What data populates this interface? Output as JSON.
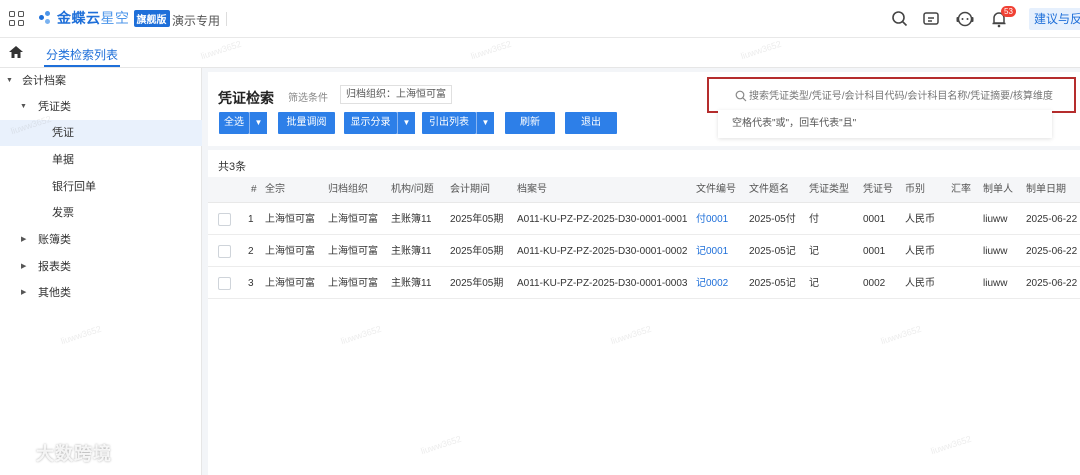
{
  "app": {
    "logo_brand": "金蝶云",
    "logo_product": "星空",
    "edition_badge": "旗舰版",
    "demo_label": "演示专用",
    "notification_count": "53",
    "suggest_button": "建议与反"
  },
  "tabs": [
    {
      "label": "分类检索列表",
      "active": true
    }
  ],
  "sidebar": {
    "items": [
      {
        "label": "会计档案",
        "level": 0,
        "expanded": true
      },
      {
        "label": "凭证类",
        "level": 1,
        "expanded": true
      },
      {
        "label": "凭证",
        "level": 2,
        "selected": true
      },
      {
        "label": "单据",
        "level": 2
      },
      {
        "label": "银行回单",
        "level": 2
      },
      {
        "label": "发票",
        "level": 2
      },
      {
        "label": "账簿类",
        "level": 1,
        "expanded": false
      },
      {
        "label": "报表类",
        "level": 1,
        "expanded": false
      },
      {
        "label": "其他类",
        "level": 1,
        "expanded": false
      }
    ]
  },
  "main": {
    "title": "凭证检索",
    "filter_label": "筛选条件",
    "filter_tag": "归档组织：上海恒可富",
    "toolbar": {
      "select_all": "全选",
      "batch_view": "批量调阅",
      "show_category": "显示分录",
      "export_list": "引出列表",
      "refresh": "刷新",
      "exit": "退出"
    },
    "search": {
      "placeholder": "搜索凭证类型/凭证号/会计科目代码/会计科目名称/凭证摘要/核算维度",
      "hint": "空格代表\"或\"，回车代表\"且\""
    },
    "count_label": "共3条",
    "table": {
      "columns": [
        "#",
        "全宗",
        "归档组织",
        "机构/问题",
        "会计期间",
        "档案号",
        "文件编号",
        "文件题名",
        "凭证类型",
        "凭证号",
        "币别",
        "汇率",
        "制单人",
        "制单日期"
      ],
      "rows": [
        [
          "1",
          "上海恒可富",
          "上海恒可富",
          "主账簿11",
          "2025年05期",
          "A011-KU-PZ-PZ-2025-D30-0001-0001",
          "付0001",
          "2025-05付",
          "付",
          "0001",
          "人民币",
          "",
          "liuww",
          "2025-06-22"
        ],
        [
          "2",
          "上海恒可富",
          "上海恒可富",
          "主账簿11",
          "2025年05期",
          "A011-KU-PZ-PZ-2025-D30-0001-0002",
          "记0001",
          "2025-05记",
          "记",
          "0001",
          "人民币",
          "",
          "liuww",
          "2025-06-22"
        ],
        [
          "3",
          "上海恒可富",
          "上海恒可富",
          "主账簿11",
          "2025年05期",
          "A011-KU-PZ-PZ-2025-D30-0001-0003",
          "记0002",
          "2025-05记",
          "记",
          "0002",
          "人民币",
          "",
          "liuww",
          "2025-06-22"
        ]
      ]
    }
  },
  "watermarks": {
    "user": "liuww3652",
    "corner": "大数跨境"
  },
  "colors": {
    "brand": "#1e6fd9",
    "button": "#2d7fe8",
    "highlight_border": "#b52d2d",
    "selected_bg": "#e9f1fc"
  }
}
